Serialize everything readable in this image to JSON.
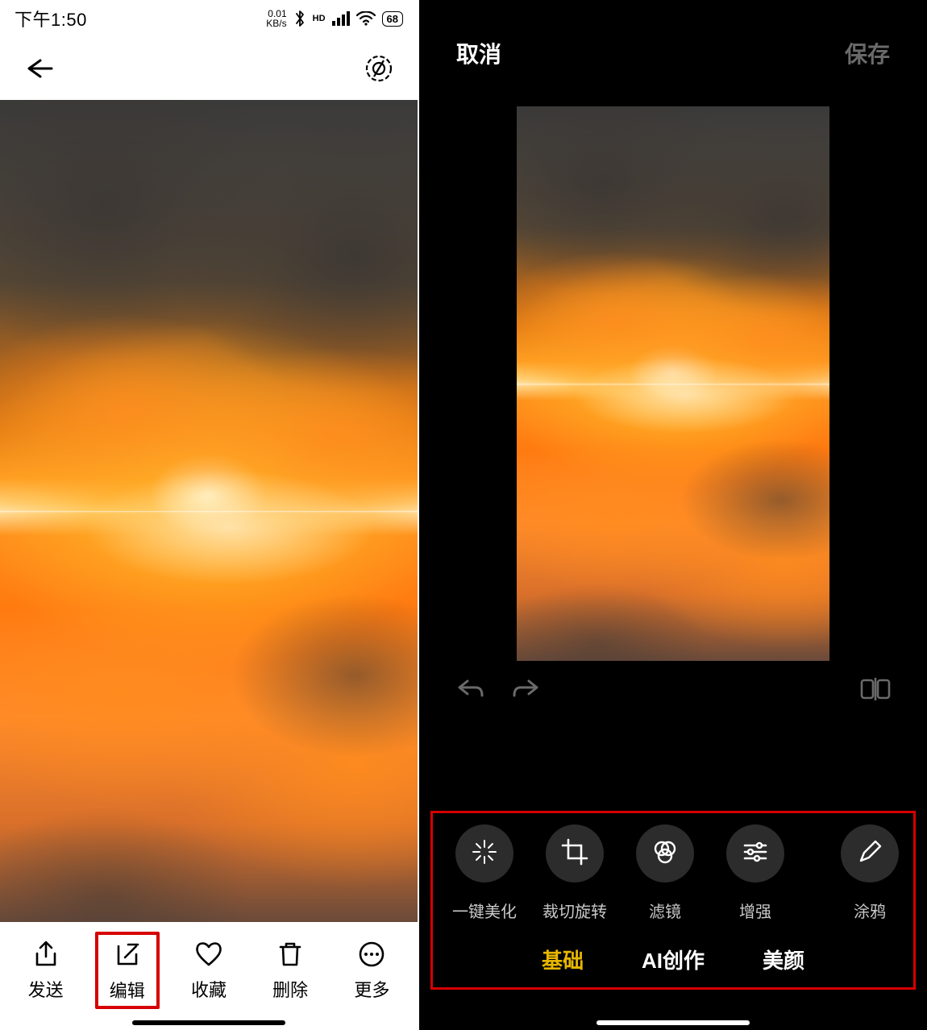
{
  "status": {
    "time": "下午1:50",
    "kbps_top": "0.01",
    "kbps_bottom": "KB/s",
    "hd_label": "HD",
    "battery_text": "68"
  },
  "left_bottom": {
    "send": "发送",
    "edit": "编辑",
    "favorite": "收藏",
    "delete": "删除",
    "more": "更多"
  },
  "edit_header": {
    "cancel": "取消",
    "save": "保存"
  },
  "tools": {
    "auto": "一键美化",
    "crop": "裁切旋转",
    "filter": "滤镜",
    "enhance": "增强",
    "doodle": "涂鸦"
  },
  "tabs": {
    "basic": "基础",
    "ai": "AI创作",
    "beauty": "美颜"
  }
}
